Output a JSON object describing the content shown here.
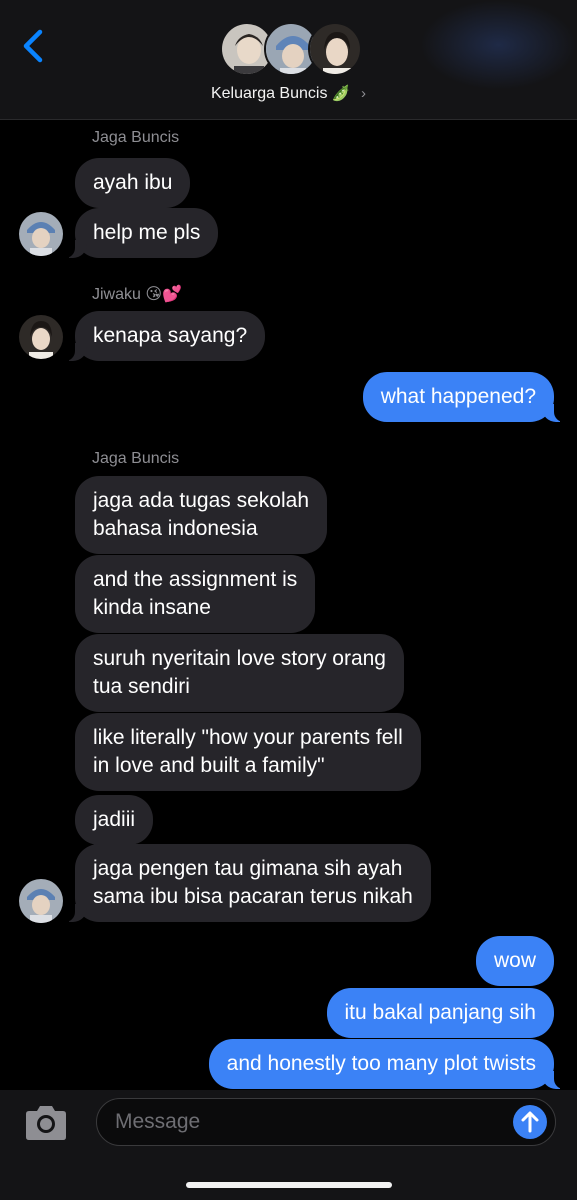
{
  "header": {
    "group_name": "Keluarga Buncis",
    "group_emoji": "🫛",
    "chevron": "›",
    "back_icon": "chevron-left-icon",
    "accent_color": "#0a84ff"
  },
  "messages": [
    {
      "sender": "Jaga Buncis",
      "text": "ayah ibu",
      "direction": "incoming"
    },
    {
      "text": "help me pls",
      "direction": "incoming",
      "avatar": "jaga"
    },
    {
      "sender": "Jiwaku 😘💕",
      "text": "kenapa sayang?",
      "direction": "incoming",
      "avatar": "jiwaku"
    },
    {
      "text": "what happened?",
      "direction": "outgoing"
    },
    {
      "sender": "Jaga Buncis",
      "text_lines": [
        "jaga ada tugas sekolah",
        "bahasa indonesia"
      ],
      "direction": "incoming"
    },
    {
      "text_lines": [
        "and the assignment is",
        "kinda insane"
      ],
      "direction": "incoming"
    },
    {
      "text_lines": [
        "suruh nyeritain love story orang",
        "tua sendiri"
      ],
      "direction": "incoming"
    },
    {
      "text_lines": [
        "like literally \"how your parents fell",
        "in love and built a family\""
      ],
      "direction": "incoming"
    },
    {
      "text": "jadiii",
      "direction": "incoming"
    },
    {
      "text_lines": [
        "jaga pengen tau gimana sih ayah",
        "sama ibu bisa pacaran terus nikah"
      ],
      "direction": "incoming",
      "avatar": "jaga"
    },
    {
      "text": "wow",
      "direction": "outgoing"
    },
    {
      "text": "itu bakal panjang sih",
      "direction": "outgoing"
    },
    {
      "text": "and honestly too many plot twists",
      "direction": "outgoing"
    }
  ],
  "composer": {
    "placeholder": "Message",
    "camera_icon": "camera-icon",
    "send_icon": "arrow-up-icon"
  },
  "colors": {
    "incoming_bubble": "#26252a",
    "outgoing_bubble": "#3b82f6",
    "sender_label": "#8e8e93",
    "background": "#000000"
  }
}
